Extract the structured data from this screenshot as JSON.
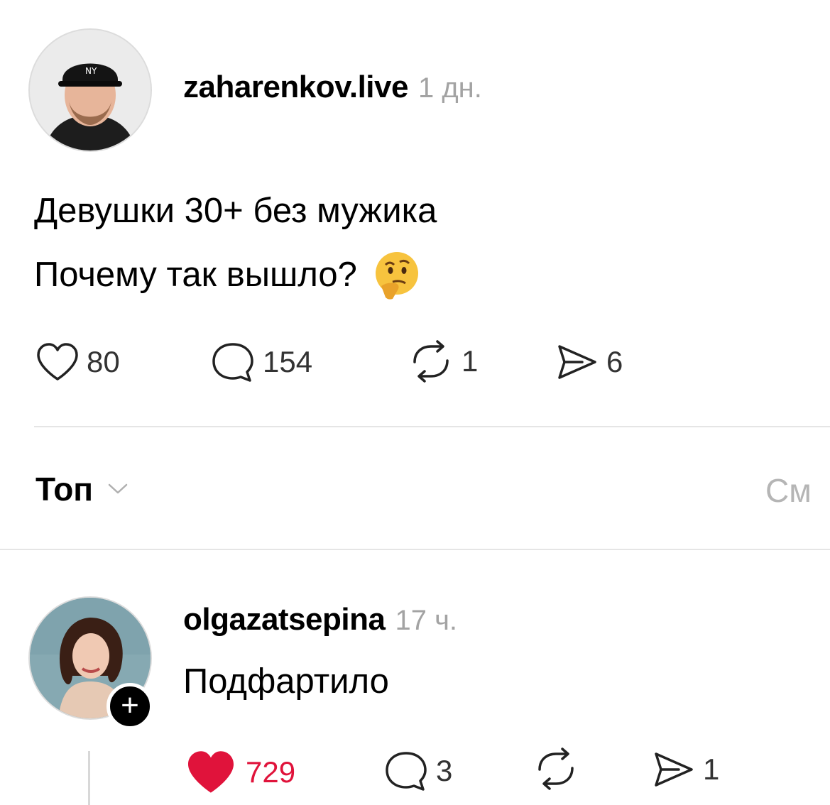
{
  "post": {
    "author": "zaharenkov.live",
    "time": "1 дн.",
    "lines": [
      "Девушки 30+ без мужика",
      "Почему так вышло?"
    ],
    "emoji": "🤔",
    "likes": "80",
    "comments": "154",
    "reposts": "1",
    "shares": "6"
  },
  "sort": {
    "label": "Топ",
    "right_label": "См"
  },
  "reply": {
    "author": "olgazatsepina",
    "time": "17 ч.",
    "text": "Подфартило",
    "likes": "729",
    "comments": "3",
    "shares": "1"
  },
  "colors": {
    "like_active": "#e0133b",
    "muted": "#a3a3a3",
    "divider": "#e5e5e5"
  },
  "icons": [
    "heart-icon",
    "comment-icon",
    "repost-icon",
    "share-icon",
    "chevron-down-icon",
    "plus-icon"
  ]
}
